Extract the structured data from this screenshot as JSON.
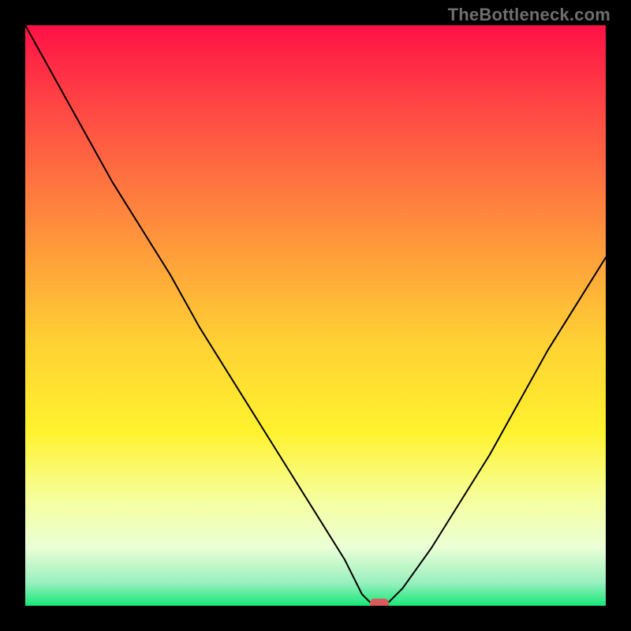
{
  "watermark": "TheBottleneck.com",
  "chart_data": {
    "type": "line",
    "title": "",
    "xlabel": "",
    "ylabel": "",
    "xlim": [
      0,
      100
    ],
    "ylim": [
      0,
      100
    ],
    "series": [
      {
        "name": "bottleneck-curve",
        "x": [
          0,
          5,
          10,
          15,
          20,
          25,
          30,
          35,
          40,
          45,
          50,
          55,
          58,
          60,
          62,
          65,
          70,
          75,
          80,
          85,
          90,
          95,
          100
        ],
        "y": [
          100,
          91,
          82,
          73,
          65,
          57,
          48,
          40,
          32,
          24,
          16,
          8,
          2,
          0,
          0,
          3,
          10,
          18,
          26,
          35,
          44,
          52,
          60
        ]
      }
    ],
    "marker": {
      "x": 61,
      "y": 0,
      "shape": "rounded-rect"
    },
    "background_gradient": {
      "stops": [
        {
          "pos": 0.0,
          "color": "#ff1146"
        },
        {
          "pos": 0.15,
          "color": "#ff4a44"
        },
        {
          "pos": 0.35,
          "color": "#ff8f3d"
        },
        {
          "pos": 0.55,
          "color": "#ffd233"
        },
        {
          "pos": 0.7,
          "color": "#fff22e"
        },
        {
          "pos": 0.82,
          "color": "#f6ffa0"
        },
        {
          "pos": 0.9,
          "color": "#eaffd6"
        },
        {
          "pos": 0.96,
          "color": "#9aefbf"
        },
        {
          "pos": 1.0,
          "color": "#17e879"
        }
      ]
    }
  }
}
